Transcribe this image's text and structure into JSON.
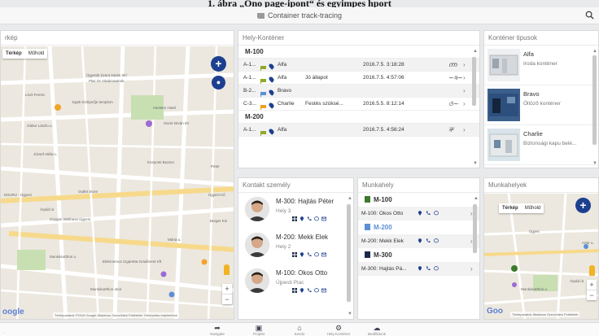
{
  "caption": "1. ábra „Ono page-ipont“ és egyimpes hport",
  "app": {
    "title": "Container track-tracing",
    "accent": "#1c3f8f"
  },
  "map_left": {
    "header": "rkép",
    "tabs": [
      "Térkép",
      "Műhold"
    ],
    "streets": [
      "Ügyeskt Szent István téri",
      "Plac és Vásárcsarnok",
      "Liszt Ferenc",
      "Egek Királynője templom",
      "Gábor Lászlo u.",
      "Szent István tér",
      "József Attila u.",
      "Központi Buzero",
      "Outlet Store",
      "Árpád út",
      "Oxygen Wellness Ügyesi",
      "Munkásotthon u.",
      "Elekronmos Cigaretta Gradiment Kft",
      "Munkásotthon utca",
      "Ügyesi Kő",
      "Burger Kin",
      "Márta u.",
      "DSURU - Ügyesi",
      "Peter",
      "rmesten Hotel"
    ],
    "google": "oogle",
    "footer": "Térképadatok ©2016 Google   Általános Szerződési Feltételek   Térképhiba bejelentése"
  },
  "hely": {
    "header": "Hely-Konténer",
    "groups": [
      {
        "name": "M-100",
        "rows": [
          {
            "id": "A-1...",
            "flag": "#8fa82a",
            "loc": "Alfa",
            "note": "",
            "date": "2016.7.5. 3:18:28",
            "sig": "ന്ന"
          },
          {
            "id": "A-1...",
            "flag": "#8fa82a",
            "loc": "Alfa",
            "note": "Jó állapot",
            "date": "2016.7.5. 4:57:06",
            "sig": "~ጓ~"
          },
          {
            "id": "B-2...",
            "flag": "#5b8fd6",
            "loc": "Bravo",
            "note": "",
            "date": "",
            "sig": ""
          },
          {
            "id": "C-3...",
            "flag": "#f0a020",
            "loc": "Charlie",
            "note": "Festés szüksé...",
            "date": "2016.5.5. 8:12:14",
            "sig": "ও~"
          }
        ]
      },
      {
        "name": "M-200",
        "rows": [
          {
            "id": "A-1...",
            "flag": "#8fa82a",
            "loc": "Alfa",
            "note": "",
            "date": "2016.7.5. 4:56:24",
            "sig": "ৰু"
          }
        ]
      }
    ]
  },
  "types": {
    "header": "Konténer tipusok",
    "items": [
      {
        "name": "Alfa",
        "desc": "Iroda konténer"
      },
      {
        "name": "Bravo",
        "desc": "Öltöző konténer"
      },
      {
        "name": "Charlie",
        "desc": "Biztonsági kapu belé..."
      }
    ]
  },
  "contacts": {
    "header": "Kontakt személy",
    "items": [
      {
        "name": "M-300: Hajtás Péter",
        "place": "Hely 3"
      },
      {
        "name": "M-200: Mekk Elek",
        "place": "Hely 2"
      },
      {
        "name": "M-100: Okos Otto",
        "place": "Újpesti Piac"
      }
    ]
  },
  "munkahely": {
    "header": "Munkahely",
    "rows": [
      {
        "kind": "group",
        "text": "M-100",
        "color": "#3b7a2a"
      },
      {
        "kind": "row",
        "text": "M-100: Okos Otto"
      },
      {
        "kind": "group",
        "text": "M-200",
        "color": "#5b8fd6",
        "light": true
      },
      {
        "kind": "row",
        "text": "M-200: Mekk Elek"
      },
      {
        "kind": "group",
        "text": "M-300",
        "color": "#1c2a4a"
      },
      {
        "kind": "row",
        "text": "M-300: Hajtás Pá..."
      }
    ]
  },
  "map_right": {
    "header": "Munkahelyek",
    "tabs": [
      "Térkép",
      "Műhold"
    ],
    "google": "Goo",
    "footer": "Térképadatok   Általános Szerződési Feltételek",
    "labels": [
      "Artúr u.",
      "Munkásotthon u.",
      "Árpád út",
      "Ügyes"
    ]
  },
  "bottom": {
    "status": "...",
    "nav": [
      "Navigate",
      "Projekt",
      "Kezdo",
      "Hely-Konténer",
      "Beállítások"
    ]
  }
}
